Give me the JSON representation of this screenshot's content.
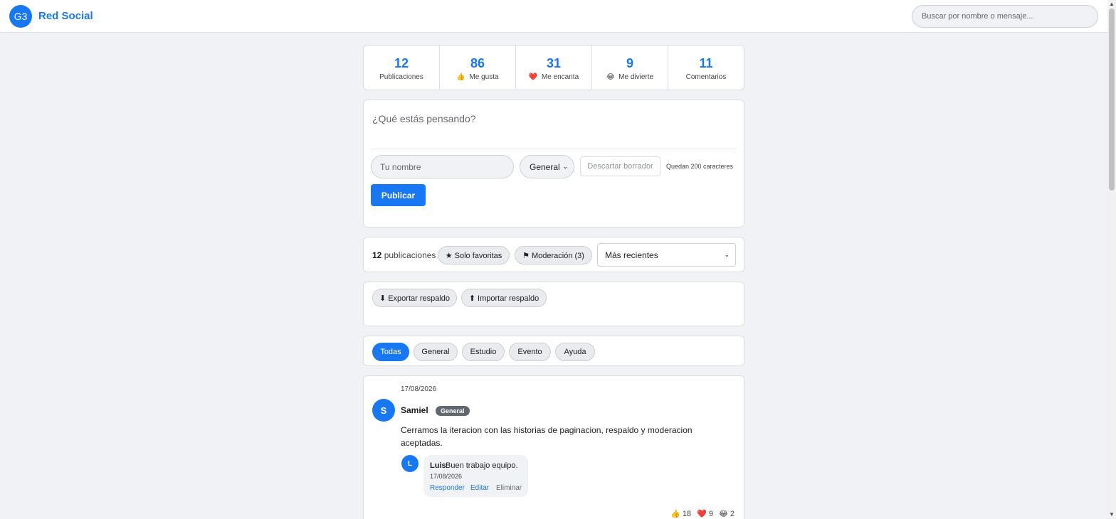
{
  "header": {
    "logo": "G3",
    "brand": "Red Social",
    "search_placeholder": "Buscar por nombre o mensaje..."
  },
  "stats": [
    {
      "value": "12",
      "icon": "",
      "label": "Publicaciones"
    },
    {
      "value": "86",
      "icon": "👍",
      "label": "Me gusta"
    },
    {
      "value": "31",
      "icon": "❤️",
      "label": "Me encanta"
    },
    {
      "value": "9",
      "icon": "😂",
      "label": "Me divierte"
    },
    {
      "value": "11",
      "icon": "",
      "label": "Comentarios"
    }
  ],
  "composer": {
    "placeholder": "¿Qué estás pensando?",
    "name_placeholder": "Tu nombre",
    "category": "General",
    "discard_label": "Descartar borrador",
    "chars_left": "Quedan 200 caracteres",
    "publish_label": "Publicar"
  },
  "filters": {
    "count": "12",
    "count_suffix": "publicaciones",
    "favorites_label": "★ Solo favoritas",
    "moderation_label": "⚑ Moderación (3)",
    "sort": "Más recientes"
  },
  "backup": {
    "export_label": "⬇ Exportar respaldo",
    "import_label": "⬆ Importar respaldo"
  },
  "tabs": [
    "Todas",
    "General",
    "Estudio",
    "Evento",
    "Ayuda"
  ],
  "post": {
    "date": "17/08/2026",
    "avatar": "S",
    "author": "Samiel",
    "category": "General",
    "text": "Cerramos la iteracion con las historias de paginacion, respaldo y moderacion aceptadas.",
    "comment": {
      "avatar": "L",
      "author": "Luis",
      "text": "Buen trabajo equipo.",
      "date": "17/08/2026",
      "reply": "Responder",
      "edit": "Editar",
      "delete": "Eliminar"
    },
    "reactions": [
      {
        "icon": "👍",
        "count": "18"
      },
      {
        "icon": "❤️",
        "count": "9"
      },
      {
        "icon": "😂",
        "count": "2"
      }
    ]
  },
  "colors": {
    "accent": "#1877f2",
    "background": "#f0f2f5",
    "badge": "#606770"
  }
}
